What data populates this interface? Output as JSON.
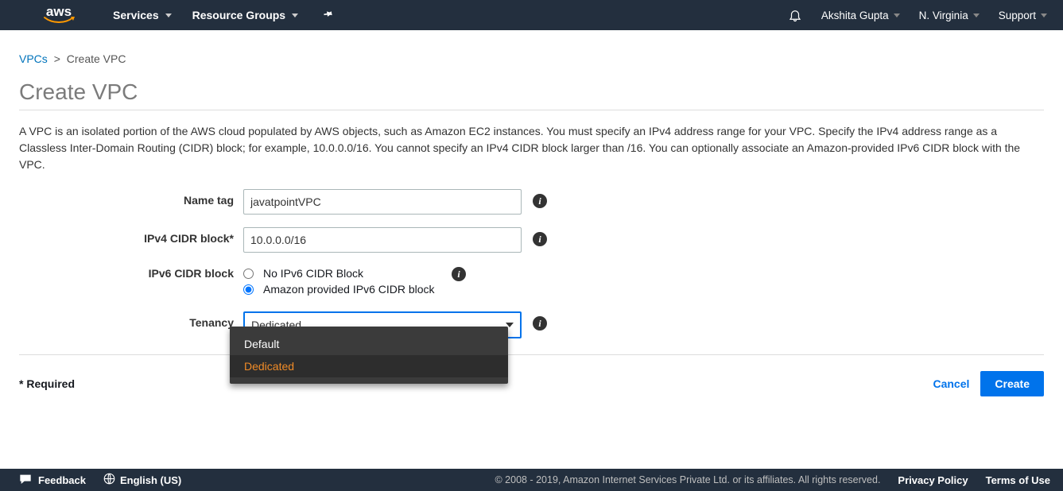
{
  "nav": {
    "logo_text": "aws",
    "services": "Services",
    "resource_groups": "Resource Groups",
    "user": "Akshita Gupta",
    "region": "N. Virginia",
    "support": "Support"
  },
  "breadcrumb": {
    "root": "VPCs",
    "sep": ">",
    "current": "Create VPC"
  },
  "title": "Create VPC",
  "description": "A VPC is an isolated portion of the AWS cloud populated by AWS objects, such as Amazon EC2 instances. You must specify an IPv4 address range for your VPC. Specify the IPv4 address range as a Classless Inter-Domain Routing (CIDR) block; for example, 10.0.0.0/16. You cannot specify an IPv4 CIDR block larger than /16. You can optionally associate an Amazon-provided IPv6 CIDR block with the VPC.",
  "form": {
    "name_tag_label": "Name tag",
    "name_tag_value": "javatpointVPC",
    "ipv4_label": "IPv4 CIDR block*",
    "ipv4_value": "10.0.0.0/16",
    "ipv6_label": "IPv6 CIDR block",
    "ipv6_options": {
      "none": "No IPv6 CIDR Block",
      "amazon": "Amazon provided IPv6 CIDR block"
    },
    "ipv6_selected": "amazon",
    "tenancy_label": "Tenancy",
    "tenancy_value": "Dedicated",
    "tenancy_options": {
      "default": "Default",
      "dedicated": "Dedicated"
    }
  },
  "footer": {
    "required": "* Required",
    "cancel": "Cancel",
    "create": "Create"
  },
  "bottom": {
    "feedback": "Feedback",
    "language": "English (US)",
    "copyright": "© 2008 - 2019, Amazon Internet Services Private Ltd. or its affiliates. All rights reserved.",
    "privacy": "Privacy Policy",
    "terms": "Terms of Use"
  },
  "colors": {
    "brand_navy": "#232f3e",
    "aws_orange": "#ff9900",
    "link_blue": "#0073bb",
    "primary_blue": "#0073eb",
    "dropdown_bg": "#3b3b3b",
    "dropdown_selected_text": "#f08b27"
  }
}
